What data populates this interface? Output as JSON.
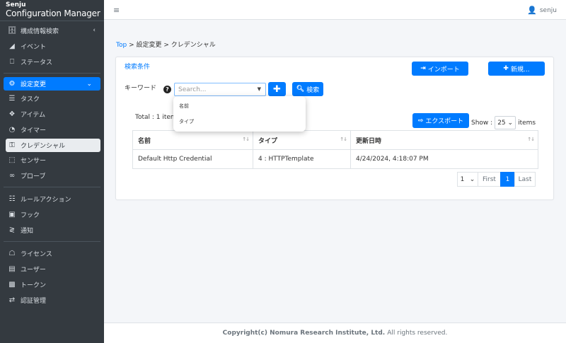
{
  "app": {
    "logo_top": "Senju",
    "logo_bottom": "Configuration Manager"
  },
  "header": {
    "menu_icon": "hamburger-icon",
    "user_name": "senju"
  },
  "sidebar": {
    "items": [
      {
        "label": "構成情報検索",
        "icon": "search-db-icon"
      },
      {
        "label": "イベント",
        "icon": "event-icon"
      },
      {
        "label": "ステータス",
        "icon": "status-icon"
      },
      {
        "label": "設定変更",
        "icon": "settings-icon"
      },
      {
        "label": "タスク",
        "icon": "task-icon"
      },
      {
        "label": "アイテム",
        "icon": "puzzle-icon"
      },
      {
        "label": "タイマー",
        "icon": "clock-icon"
      },
      {
        "label": "クレデンシャル",
        "icon": "key-icon"
      },
      {
        "label": "センサー",
        "icon": "sensor-icon"
      },
      {
        "label": "プローブ",
        "icon": "probe-icon"
      },
      {
        "label": "ルールアクション",
        "icon": "rule-icon"
      },
      {
        "label": "フック",
        "icon": "terminal-icon"
      },
      {
        "label": "通知",
        "icon": "share-icon"
      },
      {
        "label": "ライセンス",
        "icon": "lock-icon"
      },
      {
        "label": "ユーザー",
        "icon": "user-icon"
      },
      {
        "label": "トークン",
        "icon": "token-icon"
      },
      {
        "label": "認証管理",
        "icon": "exchange-icon"
      }
    ]
  },
  "breadcrumb": {
    "top": "Top",
    "level1": "> 設定変更",
    "level2": "> クレデンシャル"
  },
  "search_panel": {
    "title": "検索条件",
    "import_label": "インポート",
    "new_label": "新規...",
    "keyword_label": "キーワード",
    "search_placeholder": "Search...",
    "search_button": "検索",
    "dropdown_options": [
      "名前",
      "タイプ"
    ]
  },
  "results": {
    "total_text": "Total : 1 item",
    "export_label": "エクスポート",
    "show_label": "Show :",
    "page_size": "25",
    "items_label": "items",
    "columns": [
      "名前",
      "タイプ",
      "更新日時"
    ],
    "rows": [
      {
        "name": "Default Http Credential",
        "type": "4 : HTTPTemplate",
        "updated": "4/24/2024, 4:18:07 PM"
      }
    ]
  },
  "pagination": {
    "page_select": "1",
    "first": "First",
    "current": "1",
    "last": "Last"
  },
  "footer": {
    "company": "Copyright(c) Nomura Research Institute, Ltd.",
    "rights": "All rights reserved."
  },
  "colors": {
    "primary": "#007bff",
    "sidebar_bg": "#343a40"
  }
}
